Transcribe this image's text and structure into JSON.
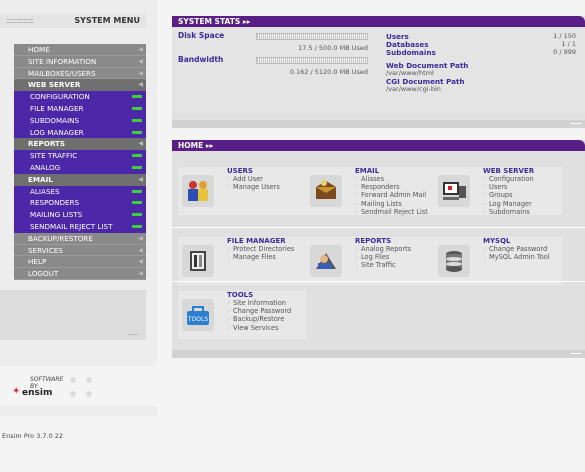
{
  "sidebar": {
    "menu_title": "SYSTEM MENU",
    "menu_dots": "::::::::::::::::",
    "items": [
      {
        "label": "HOME",
        "kind": "top"
      },
      {
        "label": "SITE INFORMATION",
        "kind": "top"
      },
      {
        "label": "MAILBOXES/USERS",
        "kind": "top"
      },
      {
        "label": "WEB SERVER",
        "kind": "head"
      },
      {
        "label": "CONFIGURATION",
        "kind": "sub"
      },
      {
        "label": "FILE MANAGER",
        "kind": "sub"
      },
      {
        "label": "SUBDOMAINS",
        "kind": "sub"
      },
      {
        "label": "LOG MANAGER",
        "kind": "sub"
      },
      {
        "label": "REPORTS",
        "kind": "head"
      },
      {
        "label": "SITE TRAFFIC",
        "kind": "sub"
      },
      {
        "label": "ANALOG",
        "kind": "sub"
      },
      {
        "label": "EMAIL",
        "kind": "head"
      },
      {
        "label": "ALIASES",
        "kind": "sub"
      },
      {
        "label": "RESPONDERS",
        "kind": "sub"
      },
      {
        "label": "MAILING LISTS",
        "kind": "sub"
      },
      {
        "label": "SENDMAIL REJECT LIST",
        "kind": "sub"
      },
      {
        "label": "BACKUP/RESTORE",
        "kind": "top"
      },
      {
        "label": "SERVICES",
        "kind": "top"
      },
      {
        "label": "HELP",
        "kind": "top"
      },
      {
        "label": "LOGOUT",
        "kind": "top"
      }
    ],
    "logo_text": "SOFTWARE BY",
    "logo_name": "ensim",
    "version": "Ensim Pro 3.7.0 22"
  },
  "stats": {
    "title": "SYSTEM STATS ▸▸",
    "disk_label": "Disk Space",
    "disk_value": "17.5 / 500.0 MB Used",
    "bandwidth_label": "Bandwidth",
    "bandwidth_value": "0.162 / 5120.0 MB Used",
    "users_label": "Users",
    "users_value": "1 / 150",
    "databases_label": "Databases",
    "databases_value": "1 / 1",
    "subdomains_label": "Subdomains",
    "subdomains_value": "0 / 999",
    "web_path_label": "Web Document Path",
    "web_path_value": "/var/www/html",
    "cgi_path_label": "CGI Document Path",
    "cgi_path_value": "/var/www/cgi-bin"
  },
  "home": {
    "title": "HOME ▸▸",
    "cards": [
      {
        "title": "USERS",
        "items": [
          "Add User",
          "Manage Users"
        ],
        "icon": "users-icon"
      },
      {
        "title": "EMAIL",
        "items": [
          "Aliases",
          "Responders",
          "Forward Admin Mail",
          "Mailing Lists",
          "Sendmail Reject List"
        ],
        "icon": "email-icon"
      },
      {
        "title": "WEB SERVER",
        "items": [
          "Configuration",
          "Users",
          "Groups",
          "Log Manager",
          "Subdomains"
        ],
        "icon": "web-server-icon"
      },
      {
        "title": "FILE MANAGER",
        "items": [
          "Protect Directories",
          "Manage Files"
        ],
        "icon": "file-manager-icon"
      },
      {
        "title": "REPORTS",
        "items": [
          "Analog Reports",
          "Log Files",
          "Site Traffic"
        ],
        "icon": "reports-icon"
      },
      {
        "title": "MYSQL",
        "items": [
          "Change Password",
          "MySQL Admin Tool"
        ],
        "icon": "mysql-icon"
      },
      {
        "title": "TOOLS",
        "items": [
          "Site Information",
          "Change Password",
          "Backup/Restore",
          "View Services"
        ],
        "icon": "tools-icon"
      }
    ]
  },
  "colors": {
    "background": "#3c2a9c",
    "title_bar": "#5a1f86",
    "accent_green": "#3fcf3a",
    "sub_item": "#4c28a8"
  }
}
